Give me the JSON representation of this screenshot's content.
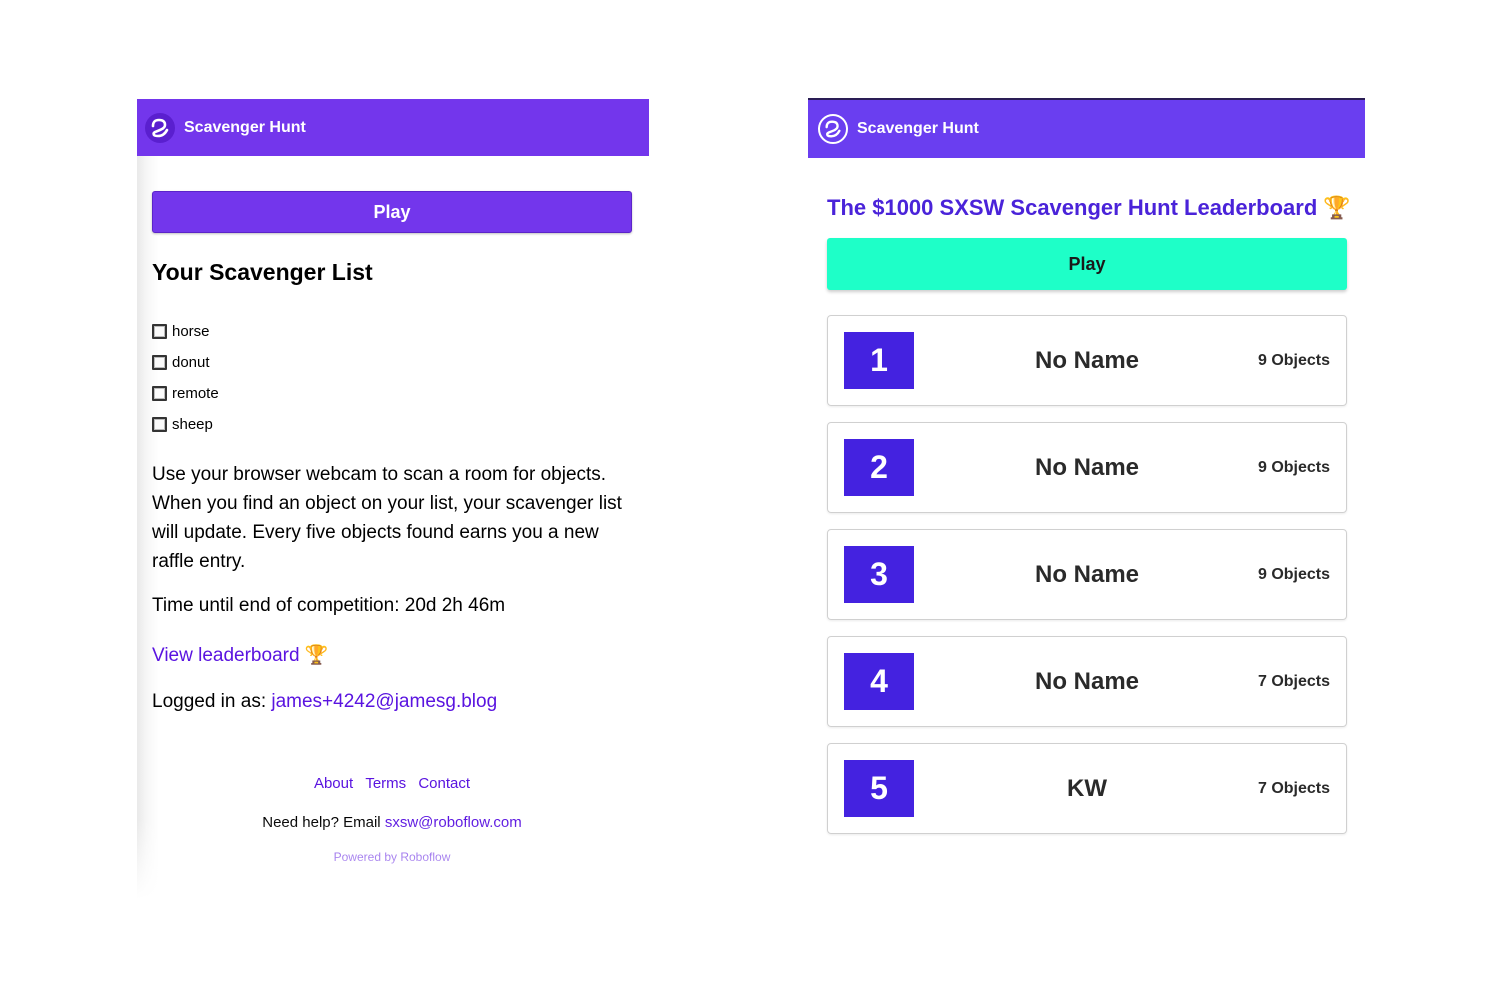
{
  "left": {
    "navbar": {
      "title": "Scavenger Hunt",
      "logo_icon": "roboflow-logo-icon"
    },
    "play_label": "Play",
    "list_title": "Your Scavenger List",
    "items": [
      "horse",
      "donut",
      "remote",
      "sheep"
    ],
    "description": "Use your browser webcam to scan a room for objects. When you find an object on your list, your scavenger list will update. Every five objects found earns you a new raffle entry.",
    "timer_label": "Time until end of competition:",
    "timer_value": "20d 2h 46m",
    "view_leaderboard": "View leaderboard",
    "trophy": "🏆",
    "logged_in_label": "Logged in as:",
    "logged_in_email": "james+4242@jamesg.blog",
    "footer": {
      "links": [
        "About",
        "Terms",
        "Contact"
      ],
      "help_text": "Need help? Email",
      "help_email": "sxsw@roboflow.com",
      "powered": "Powered by Roboflow"
    }
  },
  "right": {
    "navbar": {
      "title": "Scavenger Hunt",
      "logo_icon": "roboflow-logo-icon"
    },
    "leaderboard_title": "The $1000 SXSW Scavenger Hunt Leaderboard",
    "trophy": "🏆",
    "play_label": "Play",
    "entries": [
      {
        "rank": "1",
        "name": "No Name",
        "count": "9 Objects"
      },
      {
        "rank": "2",
        "name": "No Name",
        "count": "9 Objects"
      },
      {
        "rank": "3",
        "name": "No Name",
        "count": "9 Objects"
      },
      {
        "rank": "4",
        "name": "No Name",
        "count": "7 Objects"
      },
      {
        "rank": "5",
        "name": "KW",
        "count": "7 Objects"
      }
    ]
  },
  "colors": {
    "nav_purple_left": "#7336ec",
    "nav_purple_right": "#6a3ef0",
    "link_purple": "#5a14e0",
    "leaderboard_title": "#4a23d9",
    "rank_blue": "#4422e0",
    "play_teal": "#1effc8"
  }
}
